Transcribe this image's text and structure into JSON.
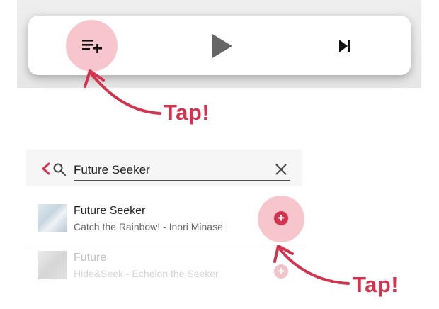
{
  "player": {
    "buttons": [
      {
        "icon": "playlist-add-icon"
      },
      {
        "icon": "play-icon"
      },
      {
        "icon": "skip-next-icon"
      }
    ]
  },
  "callouts": {
    "first": "Tap!",
    "second": "Tap!"
  },
  "search": {
    "value": "Future Seeker"
  },
  "results": [
    {
      "title": "Future Seeker",
      "subtitle": "Catch the Rainbow! - Inori Minase"
    },
    {
      "title": "Future",
      "subtitle": "Hide&Seek - Echelon the Seeker"
    }
  ],
  "colors": {
    "accent": "#d2344f",
    "highlight": "#f7c6cd"
  }
}
